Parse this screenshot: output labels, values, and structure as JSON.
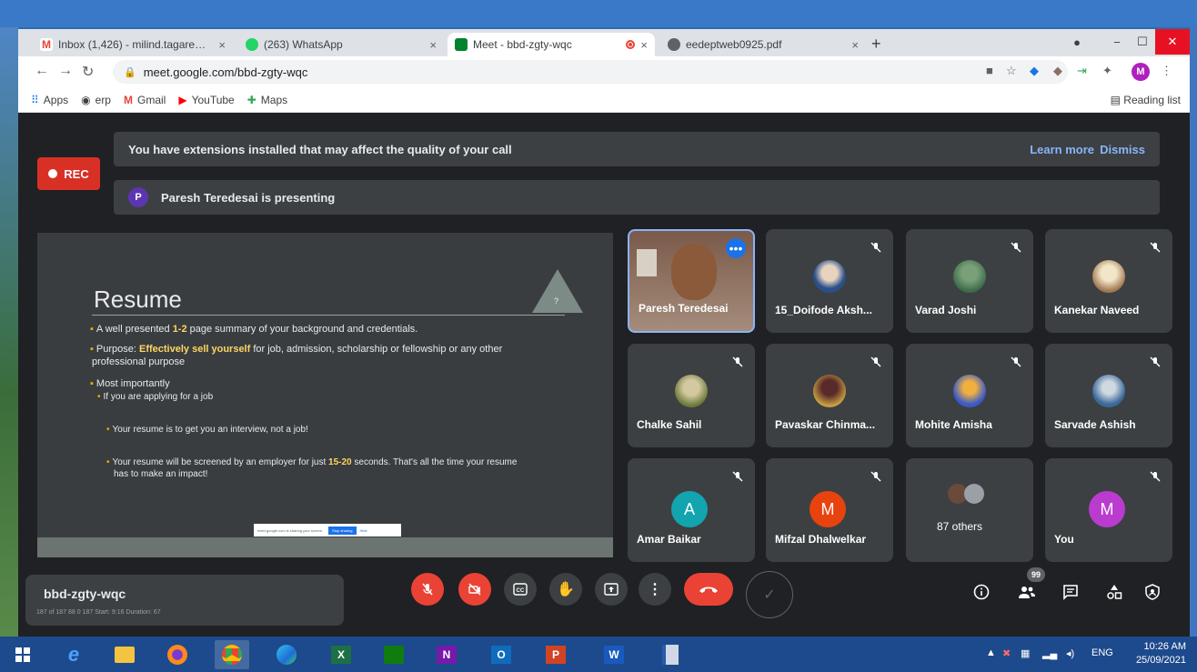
{
  "browser": {
    "tabs": [
      {
        "label": "Inbox (1,426) - milind.tagare@far",
        "icon": "gmail-icon",
        "close": "×"
      },
      {
        "label": "(263) WhatsApp",
        "icon": "whatsapp-icon",
        "close": "×"
      },
      {
        "label": "Meet - bbd-zgty-wqc",
        "icon": "meet-icon",
        "close": "×"
      },
      {
        "label": "eedeptweb0925.pdf",
        "icon": "globe-icon",
        "close": "×"
      }
    ],
    "new_tab": "+",
    "url": "meet.google.com/bbd-zgty-wqc",
    "profile_initial": "M",
    "bookmarks": [
      {
        "label": "Apps",
        "icon": "apps-grid-icon"
      },
      {
        "label": "erp",
        "icon": "globe-icon"
      },
      {
        "label": "Gmail",
        "icon": "gmail-icon"
      },
      {
        "label": "YouTube",
        "icon": "youtube-icon"
      },
      {
        "label": "Maps",
        "icon": "maps-icon"
      }
    ],
    "reading_list": "Reading list"
  },
  "meet": {
    "rec_label": "REC",
    "extensions_banner": {
      "text": "You have extensions installed that may affect the quality of your call",
      "learn_more": "Learn more",
      "dismiss": "Dismiss"
    },
    "presenting_banner": {
      "avatar": "P",
      "text": "Paresh Teredesai is presenting"
    },
    "slide": {
      "title": "Resume",
      "triangle_label": "?",
      "line1_pre": "A well presented ",
      "line1_hl": "1-2",
      "line1_post": " page summary of your background and credentials.",
      "line2_pre": "Purpose: ",
      "line2_hl": "Effectively sell yourself",
      "line2_post": " for job, admission, scholarship or fellowship or any other",
      "line2b": "professional purpose",
      "line3": "Most importantly",
      "line4": "If you are applying for a job",
      "line5": "Your resume is to get you an interview, not a job!",
      "line6_pre": "Your resume will be screened by an employer for just ",
      "line6_hl": "15-20",
      "line6_post": " seconds. That's all the time your resume",
      "line6b": "has to make an impact!",
      "share_text": "meet.google.com is sharing your screen.",
      "stop_sharing": "Stop sharing",
      "hide": "Hide"
    },
    "participants": [
      {
        "name": "Paresh Teredesai"
      },
      {
        "name": "15_Doifode Aksh..."
      },
      {
        "name": "Varad Joshi"
      },
      {
        "name": "Kanekar Naveed"
      },
      {
        "name": "Chalke Sahil"
      },
      {
        "name": "Pavaskar Chinma..."
      },
      {
        "name": "Mohite Amisha"
      },
      {
        "name": "Sarvade Ashish"
      },
      {
        "name": "Amar Baikar",
        "initial": "A",
        "color": "#12a4af"
      },
      {
        "name": "Mifzal Dhalwelkar",
        "initial": "M",
        "color": "#e8430e"
      },
      {
        "name": "87 others"
      },
      {
        "name": "You",
        "initial": "M",
        "color": "#b93ccf"
      }
    ],
    "meeting_code": "bbd-zgty-wqc",
    "meeting_overlay": "187 of 187   88   0   187  Start: 9:16 Duration: 67",
    "people_count": "99"
  },
  "taskbar": {
    "apps": [
      {
        "label": "",
        "icon": "windows-start-icon"
      },
      {
        "label": "",
        "icon": "internet-explorer-icon"
      },
      {
        "label": "",
        "icon": "file-explorer-icon"
      },
      {
        "label": "",
        "icon": "firefox-icon"
      },
      {
        "label": "",
        "icon": "chrome-icon"
      },
      {
        "label": "",
        "icon": "edge-icon"
      },
      {
        "label": "X",
        "icon": "excel-icon"
      },
      {
        "label": "",
        "icon": "store-icon"
      },
      {
        "label": "N",
        "icon": "onenote-icon"
      },
      {
        "label": "O",
        "icon": "outlook-icon"
      },
      {
        "label": "P",
        "icon": "powerpoint-icon"
      },
      {
        "label": "W",
        "icon": "word-icon"
      },
      {
        "label": "",
        "icon": "app-icon"
      }
    ],
    "language": "ENG",
    "time": "10:26 AM",
    "date": "25/09/2021"
  },
  "colors": {
    "accent": "#1a73e8",
    "danger": "#ea4335",
    "meet_bg": "#202124",
    "tile_bg": "#3c4043"
  }
}
